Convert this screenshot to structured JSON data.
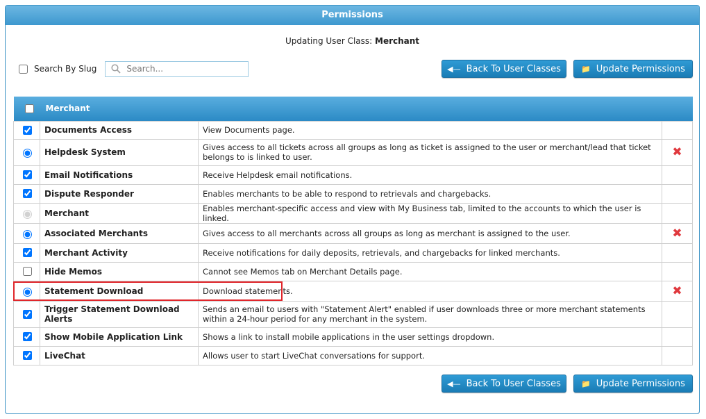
{
  "header": {
    "title": "Permissions"
  },
  "subtitle": {
    "prefix": "Updating User Class: ",
    "value": "Merchant"
  },
  "search": {
    "checkbox_label": "Search By Slug",
    "placeholder": "Search...",
    "value": ""
  },
  "buttons": {
    "back_label": "Back To User Classes",
    "update_label": "Update Permissions"
  },
  "table": {
    "group_title": "Merchant",
    "rows": [
      {
        "control": "checkbox",
        "checked": true,
        "name": "Documents Access",
        "description": "View Documents page.",
        "removable": false
      },
      {
        "control": "radio",
        "checked": true,
        "name": "Helpdesk System",
        "description": "Gives access to all tickets across all groups as long as ticket is assigned to the user or merchant/lead that ticket belongs to is linked to user.",
        "removable": true
      },
      {
        "control": "checkbox",
        "checked": true,
        "name": "Email Notifications",
        "description": "Receive Helpdesk email notifications.",
        "removable": false
      },
      {
        "control": "checkbox",
        "checked": true,
        "name": "Dispute Responder",
        "description": "Enables merchants to be able to respond to retrievals and chargebacks.",
        "removable": false
      },
      {
        "control": "radio-disabled",
        "checked": true,
        "name": "Merchant",
        "description": "Enables merchant-specific access and view with My Business tab, limited to the accounts to which the user is linked.",
        "removable": false
      },
      {
        "control": "radio",
        "checked": true,
        "name": "Associated Merchants",
        "description": "Gives access to all merchants across all groups as long as merchant is assigned to the user.",
        "removable": true
      },
      {
        "control": "checkbox",
        "checked": true,
        "name": "Merchant Activity",
        "description": "Receive notifications for daily deposits, retrievals, and chargebacks for linked merchants.",
        "removable": false
      },
      {
        "control": "checkbox",
        "checked": false,
        "name": "Hide Memos",
        "description": "Cannot see Memos tab on Merchant Details page.",
        "removable": false
      },
      {
        "control": "radio",
        "checked": true,
        "name": "Statement Download",
        "description": "Download statements.",
        "removable": true
      },
      {
        "control": "checkbox",
        "checked": true,
        "name": "Trigger Statement Download Alerts",
        "description": "Sends an email to users with \"Statement Alert\" enabled if user downloads three or more merchant statements within a 24-hour period for any merchant in the system.",
        "removable": false
      },
      {
        "control": "checkbox",
        "checked": true,
        "name": "Show Mobile Application Link",
        "description": "Shows a link to install mobile applications in the user settings dropdown.",
        "removable": false
      },
      {
        "control": "checkbox",
        "checked": true,
        "name": "LiveChat",
        "description": "Allows user to start LiveChat conversations for support.",
        "removable": false
      }
    ]
  },
  "icons": {
    "back": "arrow-left-icon",
    "update": "folder-icon",
    "remove": "red-x-icon",
    "search": "magnifier-icon"
  },
  "colors": {
    "accent": "#2b8ac5",
    "remove": "#e0393e",
    "highlight": "#e0262b"
  }
}
